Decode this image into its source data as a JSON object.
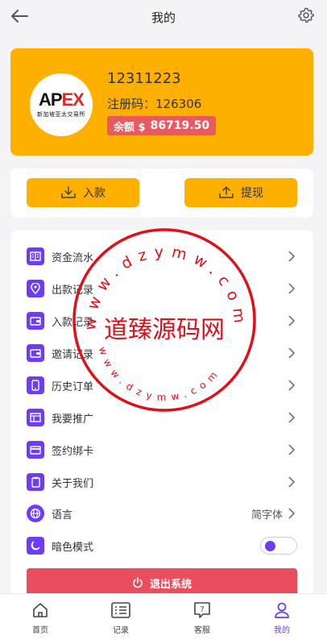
{
  "header": {
    "title": "我的",
    "back_icon": "arrow-left-icon",
    "settings_icon": "gear-icon"
  },
  "user": {
    "logo_brand": "APEX",
    "logo_sub": "新加坡亚太交易所",
    "uid": "12311223",
    "reg_code_label": "注册码：",
    "reg_code": "126306",
    "balance_label": "余额 $",
    "balance": "86719.50"
  },
  "actions": {
    "deposit": "入款",
    "withdraw": "提现"
  },
  "menu": {
    "items": [
      {
        "label": "资金流水",
        "icon": "ledger-icon"
      },
      {
        "label": "出款记录",
        "icon": "location-pin-icon"
      },
      {
        "label": "入款记录",
        "icon": "wallet-icon"
      },
      {
        "label": "邀请记录",
        "icon": "wallet-invite-icon"
      },
      {
        "label": "历史订单",
        "icon": "phone-order-icon"
      },
      {
        "label": "我要推广",
        "icon": "promote-icon"
      },
      {
        "label": "签约绑卡",
        "icon": "card-icon"
      },
      {
        "label": "关于我们",
        "icon": "clipboard-icon"
      },
      {
        "label": "语言",
        "icon": "globe-icon",
        "value": "简字体"
      },
      {
        "label": "暗色模式",
        "icon": "moon-icon"
      }
    ]
  },
  "dark_mode": false,
  "logout": "退出系统",
  "watermark": {
    "main": "道臻源码网",
    "ring_top": "www.dzymw.com",
    "ring_bottom": "www.dzymw.com"
  },
  "tabbar": {
    "items": [
      {
        "label": "首页",
        "icon": "home-icon"
      },
      {
        "label": "记录",
        "icon": "list-icon"
      },
      {
        "label": "客服",
        "icon": "help-chat-icon"
      },
      {
        "label": "我的",
        "icon": "user-icon",
        "active": true
      }
    ]
  },
  "colors": {
    "accent": "#fdb000",
    "primary": "#6c3df2",
    "danger": "#e94e5f",
    "stamp": "#e0101a"
  }
}
